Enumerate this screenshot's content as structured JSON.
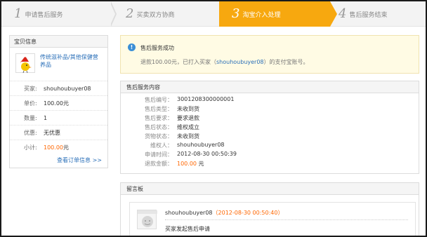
{
  "steps": [
    {
      "num": "1",
      "label": "申请售后服务"
    },
    {
      "num": "2",
      "label": "买卖双方协商"
    },
    {
      "num": "3",
      "label": "淘宝介入处理"
    },
    {
      "num": "4",
      "label": "售后服务结束"
    }
  ],
  "colors": {
    "accent": "#f7a80f",
    "link": "#2a6fb8",
    "price": "#ff6600"
  },
  "product_panel": {
    "header": "宝贝信息",
    "title": "传统滋补品/其他保健营养品",
    "rows": [
      {
        "key": "买家:",
        "value": "shouhoubuyer08"
      },
      {
        "key": "单价:",
        "value": "100.00元"
      },
      {
        "key": "数量:",
        "value": "1"
      },
      {
        "key": "优惠:",
        "value": "无优惠"
      },
      {
        "key": "小计:",
        "value": "100.00",
        "unit": "元"
      }
    ],
    "order_link": "查看订单信息 >>"
  },
  "notice": {
    "title": "售后服务成功",
    "text_before": "退款100.00元，已打入买家（",
    "account": "shouhoubuyer08",
    "text_after": "）的支付宝账号。"
  },
  "detail": {
    "header": "售后服务内容",
    "rows": [
      {
        "key": "售后编号：",
        "value": "3001208300000001"
      },
      {
        "key": "售后类型：",
        "value": "未收到货"
      },
      {
        "key": "售后要求：",
        "value": "要求退款"
      },
      {
        "key": "售后状态：",
        "value": "维权成立"
      },
      {
        "key": "货物状态：",
        "value": "未收到货"
      },
      {
        "key": "维权人：",
        "value": "shouhoubuyer08"
      },
      {
        "key": "申请时间：",
        "value": "2012-08-30 00:50:39"
      },
      {
        "key": "退款金额：",
        "value": "100.00",
        "unit": "元"
      }
    ]
  },
  "messages": {
    "header": "留言板",
    "items": [
      {
        "author": "shouhoubuyer08",
        "time": "（2012-08-30 00:50:40）",
        "content": "买家发起售后申请"
      }
    ]
  }
}
